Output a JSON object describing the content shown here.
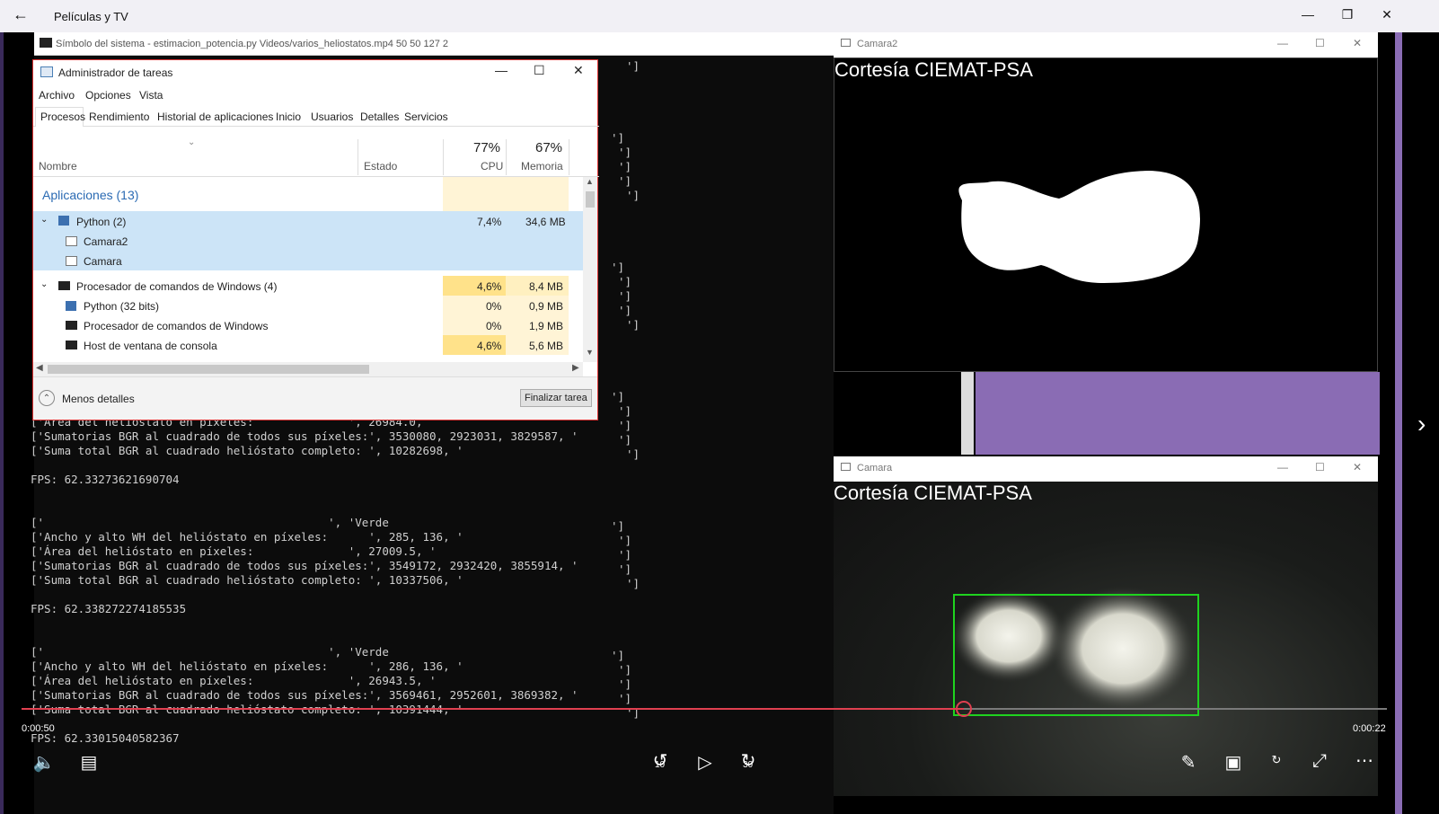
{
  "app": {
    "title": "Películas y TV"
  },
  "console": {
    "title": "Símbolo del sistema - estimacion_potencia.py  Videos/varios_heliostatos.mp4 50 50 127 2",
    "lines": [
      "['Área del helióstato en píxeles:              ', 26984.0,",
      "['Sumatorias BGR al cuadrado de todos sus píxeles:', 3530080, 2923031, 3829587, '",
      "['Suma total BGR al cuadrado helióstato completo: ', 10282698, '",
      "FPS: 62.33273621690704",
      "['                                          ', 'Verde",
      "['Ancho y alto WH del helióstato en píxeles:      ', 285, 136, '",
      "['Área del helióstato en píxeles:              ', 27009.5, '",
      "['Sumatorias BGR al cuadrado de todos sus píxeles:', 3549172, 2932420, 3855914, '",
      "['Suma total BGR al cuadrado helióstato completo: ', 10337506, '",
      "FPS: 62.338272274185535",
      "['                                          ', 'Verde",
      "['Ancho y alto WH del helióstato en píxeles:      ', 286, 136, '",
      "['Área del helióstato en píxeles:              ', 26943.5, '",
      "['Sumatorias BGR al cuadrado de todos sus píxeles:', 3569461, 2952601, 3869382, '",
      "['Suma total BGR al cuadrado helióstato completo: ', 10391444, '",
      "FPS: 62.33015040582367"
    ],
    "bracket": "']"
  },
  "taskmanager": {
    "title": "Administrador de tareas",
    "menu": [
      "Archivo",
      "Opciones",
      "Vista"
    ],
    "tabs": [
      "Procesos",
      "Rendimiento",
      "Historial de aplicaciones",
      "Inicio",
      "Usuarios",
      "Detalles",
      "Servicios"
    ],
    "columns": {
      "name": "Nombre",
      "status": "Estado",
      "cpu_pct": "77%",
      "cpu": "CPU",
      "mem_pct": "67%",
      "mem": "Memoria"
    },
    "group": "Aplicaciones (13)",
    "rows": [
      {
        "name": "Python (2)",
        "cpu": "7,4%",
        "mem": "34,6 MB"
      },
      {
        "name": "Camara2",
        "cpu": "",
        "mem": ""
      },
      {
        "name": "Camara",
        "cpu": "",
        "mem": ""
      },
      {
        "name": "Procesador de comandos de Windows (4)",
        "cpu": "4,6%",
        "mem": "8,4 MB"
      },
      {
        "name": "Python (32 bits)",
        "cpu": "0%",
        "mem": "0,9 MB"
      },
      {
        "name": "Procesador de comandos de Windows",
        "cpu": "0%",
        "mem": "1,9 MB"
      },
      {
        "name": "Host de ventana de consola",
        "cpu": "4,6%",
        "mem": "5,6 MB"
      }
    ],
    "less_details": "Menos detalles",
    "end_task": "Finalizar tarea"
  },
  "camara2": {
    "title": "Camara2",
    "overlay": "Cortesía CIEMAT-PSA"
  },
  "camara": {
    "title": "Camara",
    "overlay": "Cortesía CIEMAT-PSA"
  },
  "player": {
    "elapsed": "0:00:50",
    "remaining": "0:00:22",
    "progress": 0.69,
    "skip_back": "10",
    "skip_fwd": "30"
  }
}
